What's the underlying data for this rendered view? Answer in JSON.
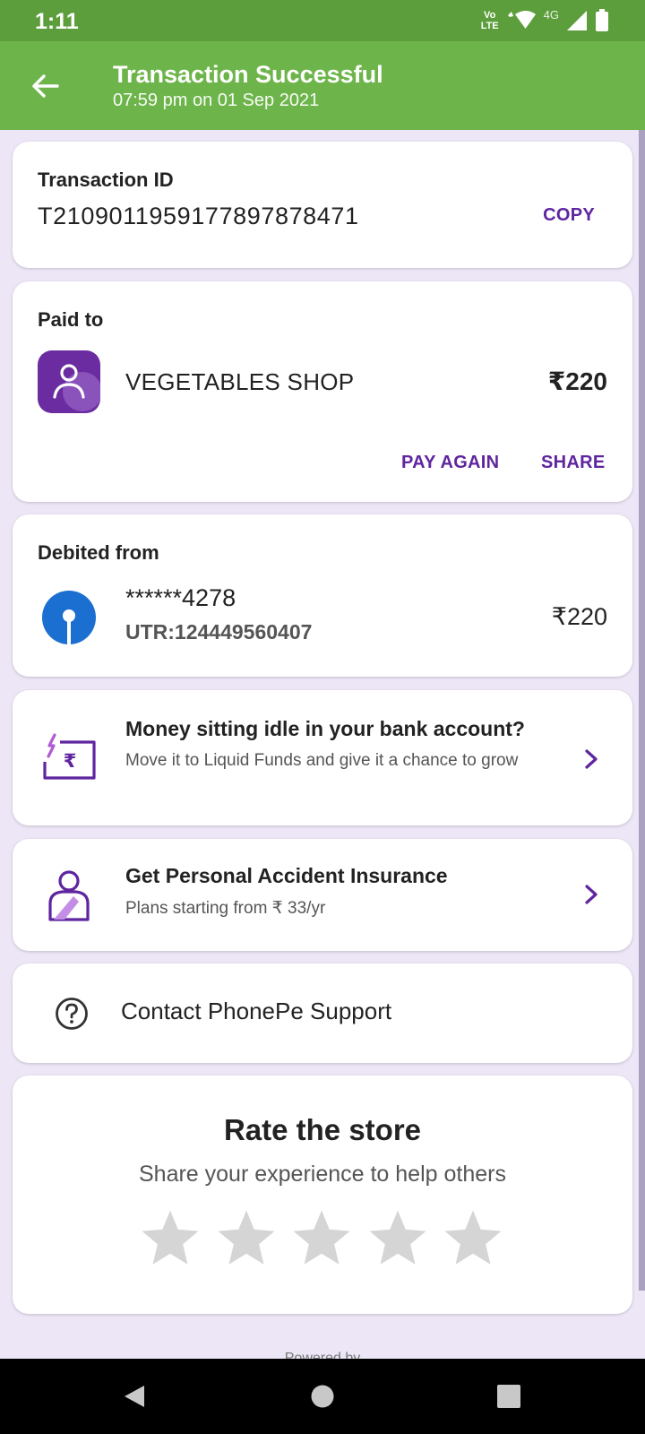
{
  "status_bar": {
    "time": "1:11",
    "volte_top": "Vo",
    "volte_bottom": "LTE",
    "network": "4G"
  },
  "header": {
    "title": "Transaction Successful",
    "subtitle": "07:59 pm on 01 Sep 2021"
  },
  "transaction": {
    "id_label": "Transaction ID",
    "id_value": "T2109011959177897878471",
    "copy_label": "COPY"
  },
  "paid_to": {
    "label": "Paid to",
    "name": "VEGETABLES SHOP",
    "amount": "₹220",
    "pay_again_label": "PAY AGAIN",
    "share_label": "SHARE"
  },
  "debited_from": {
    "label": "Debited from",
    "account": "******4278",
    "utr": "UTR:124449560407",
    "amount": "₹220"
  },
  "promos": [
    {
      "title": "Money sitting idle in your bank account?",
      "description": "Move it to Liquid Funds and give it a chance to grow",
      "icon": "liquid-funds-icon"
    },
    {
      "title": "Get Personal Accident Insurance",
      "description": "Plans starting from ₹ 33/yr",
      "icon": "insurance-icon"
    }
  ],
  "support": {
    "label": "Contact PhonePe Support"
  },
  "rating": {
    "title": "Rate the store",
    "subtitle": "Share your experience to help others",
    "stars_total": 5,
    "stars_selected": 0
  },
  "footer": {
    "powered": "Powered by"
  },
  "colors": {
    "status_bar": "#5c9e3c",
    "app_bar": "#6db54a",
    "accent": "#5f259f",
    "background": "#ece6f7",
    "bank_blue": "#1a6fd0"
  }
}
